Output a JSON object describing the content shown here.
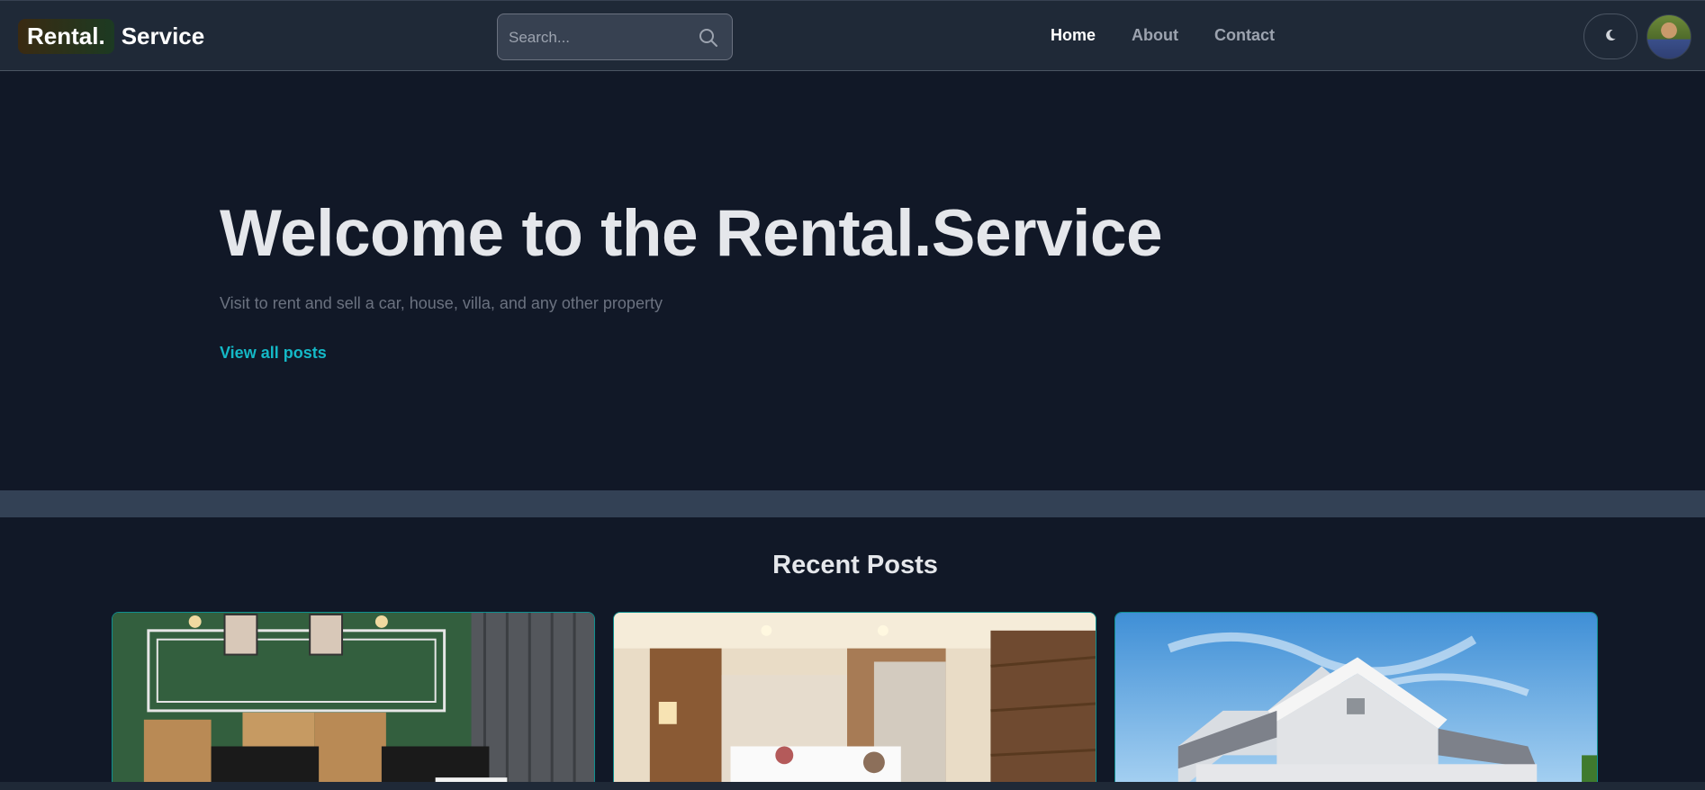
{
  "header": {
    "logo_badge": "Rental.",
    "logo_rest": "Service",
    "search_placeholder": "Search...",
    "nav": [
      {
        "label": "Home",
        "active": true
      },
      {
        "label": "About",
        "active": false
      },
      {
        "label": "Contact",
        "active": false
      }
    ],
    "icons": {
      "search": "search-icon",
      "theme": "moon-icon",
      "avatar": "user-avatar"
    }
  },
  "hero": {
    "title": "Welcome to the Rental.Service",
    "subtitle": "Visit to rent and sell a car, house, villa, and any other property",
    "link": "View all posts"
  },
  "recent": {
    "title": "Recent Posts",
    "posts": [
      {
        "image": "hostel-room-photo"
      },
      {
        "image": "hotel-room-photo"
      },
      {
        "image": "house-photo"
      }
    ]
  },
  "colors": {
    "background": "#111827",
    "header": "#1f2937",
    "accent": "#14b8c6",
    "card_border": "#0f8f8f"
  }
}
